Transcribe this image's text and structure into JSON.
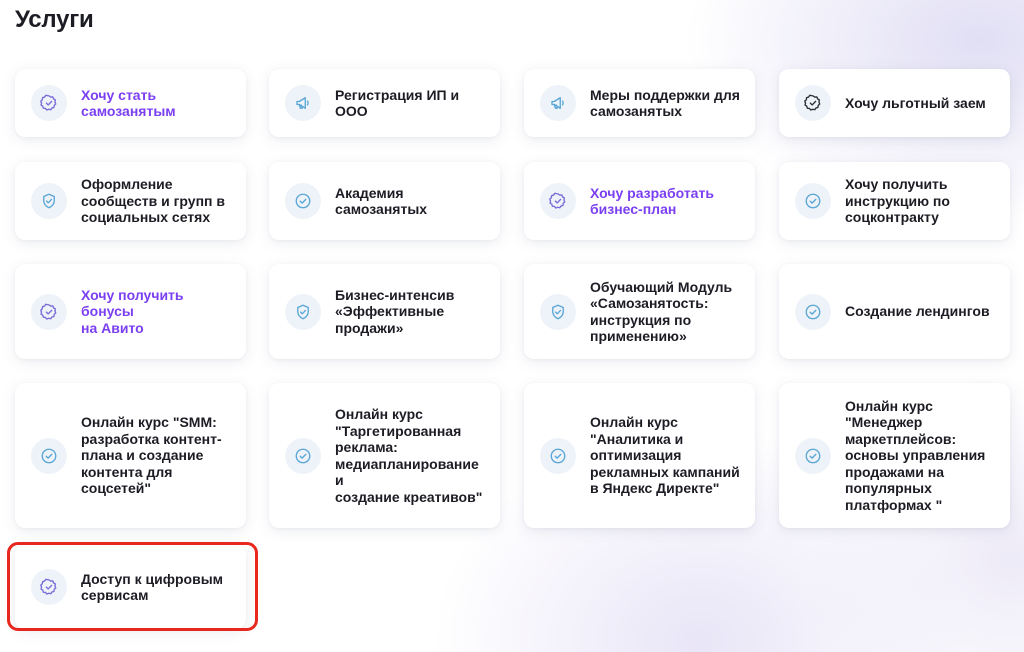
{
  "page": {
    "title": "Услуги"
  },
  "colors": {
    "accent": "#7b3ff2",
    "text": "#1c1c24",
    "icon_bg": "#eef3f9",
    "highlight": "#e8271f"
  },
  "services": [
    {
      "label": "Хочу стать\nсамозанятым",
      "icon": "badge-check-icon",
      "accent": true
    },
    {
      "label": "Регистрация ИП и\nООО",
      "icon": "megaphone-icon",
      "accent": false
    },
    {
      "label": "Меры поддержки для\nсамозанятых",
      "icon": "megaphone-icon",
      "accent": false
    },
    {
      "label": "Хочу льготный заем",
      "icon": "badge-check-icon",
      "accent": false
    },
    {
      "label": "Оформление\nсообществ и групп в\nсоциальных сетях",
      "icon": "shield-check-icon",
      "accent": false
    },
    {
      "label": "Академия\nсамозанятых",
      "icon": "check-circle-icon",
      "accent": false
    },
    {
      "label": "Хочу разработать\nбизнес-план",
      "icon": "badge-check-icon",
      "accent": true
    },
    {
      "label": "Хочу получить\nинструкцию по\nсоцконтракту",
      "icon": "check-circle-icon",
      "accent": false
    },
    {
      "label": "Хочу получить бонусы\nна Авито",
      "icon": "badge-check-icon",
      "accent": true
    },
    {
      "label": "Бизнес-интенсив\n«Эффективные\nпродажи»",
      "icon": "shield-check-icon",
      "accent": false
    },
    {
      "label": "Обучающий Модуль\n«Самозанятость:\nинструкция по\nприменению»",
      "icon": "shield-check-icon",
      "accent": false
    },
    {
      "label": "Создание лендингов",
      "icon": "check-circle-icon",
      "accent": false
    },
    {
      "label": "Онлайн курс \"SMM:\nразработка контент-\nплана и создание\nконтента для\nсоцсетей\"",
      "icon": "check-circle-icon",
      "accent": false
    },
    {
      "label": "Онлайн курс\n\"Таргетированная\nреклама:\nмедиапланирование и\nсоздание креативов\"",
      "icon": "check-circle-icon",
      "accent": false
    },
    {
      "label": "Онлайн курс\n\"Аналитика и\nоптимизация\nрекламных кампаний\nв Яндекс Директе\"",
      "icon": "check-circle-icon",
      "accent": false
    },
    {
      "label": "Онлайн курс\n\"Менеджер\nмаркетплейсов:\nосновы управления\nпродажами на\nпопулярных\nплатформах \"",
      "icon": "check-circle-icon",
      "accent": false
    },
    {
      "label": "Доступ к цифровым\nсервисам",
      "icon": "badge-check-icon",
      "accent": false,
      "highlighted": true
    }
  ]
}
